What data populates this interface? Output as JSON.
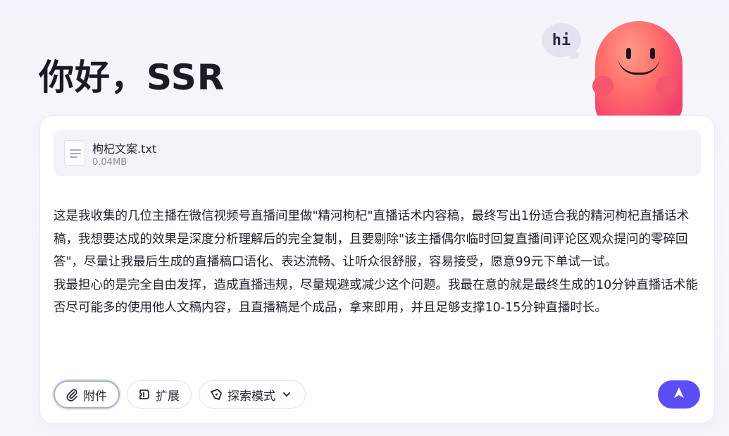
{
  "greeting": "你好，SSR",
  "mascot": {
    "speech": "hi"
  },
  "attachment": {
    "icon": "text-file-icon",
    "name": "枸杞文案.txt",
    "size": "0.04MB"
  },
  "prompt": "这是我收集的几位主播在微信视频号直播间里做\"精河枸杞\"直播话术内容稿，最终写出1份适合我的精河枸杞直播话术稿，我想要达成的效果是深度分析理解后的完全复制，且要剔除\"该主播偶尔临时回复直播间评论区观众提问的零碎回答\"，尽量让我最后生成的直播稿口语化、表达流畅、让听众很舒服，容易接受，愿意99元下单试一试。\n我最担心的是完全自由发挥，造成直播违规，尽量规避或减少这个问题。我最在意的就是最终生成的10分钟直播话术能否尽可能多的使用他人文稿内容，且直播稿是个成品，拿来即用，并且足够支撑10-15分钟直播时长。",
  "toolbar": {
    "attach_label": "附件",
    "extend_label": "扩展",
    "mode_label": "探索模式"
  },
  "colors": {
    "send_button": "#5b4ef5",
    "background": "#f6f6fa"
  }
}
